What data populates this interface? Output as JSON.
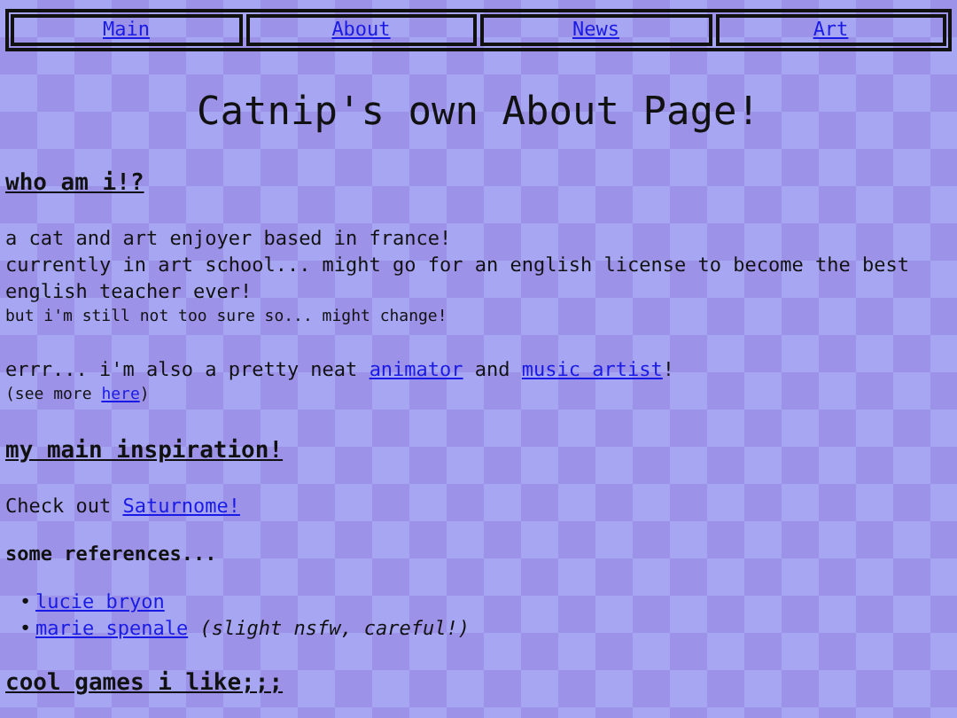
{
  "nav": [
    {
      "label": "Main"
    },
    {
      "label": "About"
    },
    {
      "label": "News"
    },
    {
      "label": "Art"
    }
  ],
  "title": "Catnip's own About Page!",
  "blocks": [
    {
      "kind": "heading",
      "text": "who am i!?"
    },
    {
      "kind": "para",
      "parts": [
        {
          "kind": "text",
          "text": "a cat and art enjoyer based in france!"
        }
      ]
    },
    {
      "kind": "para",
      "parts": [
        {
          "kind": "text",
          "text": "currently in art school... might go for an english license to become the best english teacher ever!"
        }
      ]
    },
    {
      "kind": "note",
      "parts": [
        {
          "kind": "text",
          "text": "but i'm still not too sure so... might change!"
        }
      ]
    },
    {
      "kind": "gap"
    },
    {
      "kind": "para",
      "parts": [
        {
          "kind": "text",
          "text": "errr... i'm also a pretty neat "
        },
        {
          "kind": "link",
          "text": "animator"
        },
        {
          "kind": "text",
          "text": " and "
        },
        {
          "kind": "link",
          "text": "music artist"
        },
        {
          "kind": "text",
          "text": "!"
        }
      ]
    },
    {
      "kind": "note",
      "parts": [
        {
          "kind": "text",
          "text": "(see more "
        },
        {
          "kind": "link",
          "text": "here"
        },
        {
          "kind": "text",
          "text": ")"
        }
      ]
    },
    {
      "kind": "heading",
      "text": "my main inspiration!"
    },
    {
      "kind": "para",
      "parts": [
        {
          "kind": "text",
          "text": "Check out "
        },
        {
          "kind": "link",
          "text": "Saturnome!"
        }
      ]
    },
    {
      "kind": "subheading",
      "text": "some references..."
    },
    {
      "kind": "list",
      "items": [
        {
          "marker": "•",
          "link": "lucie bryon"
        },
        {
          "marker": "•",
          "link": "marie spenale",
          "note": "(slight nsfw, careful!)"
        }
      ]
    },
    {
      "kind": "heading",
      "text": "cool games i like;;;"
    }
  ]
}
